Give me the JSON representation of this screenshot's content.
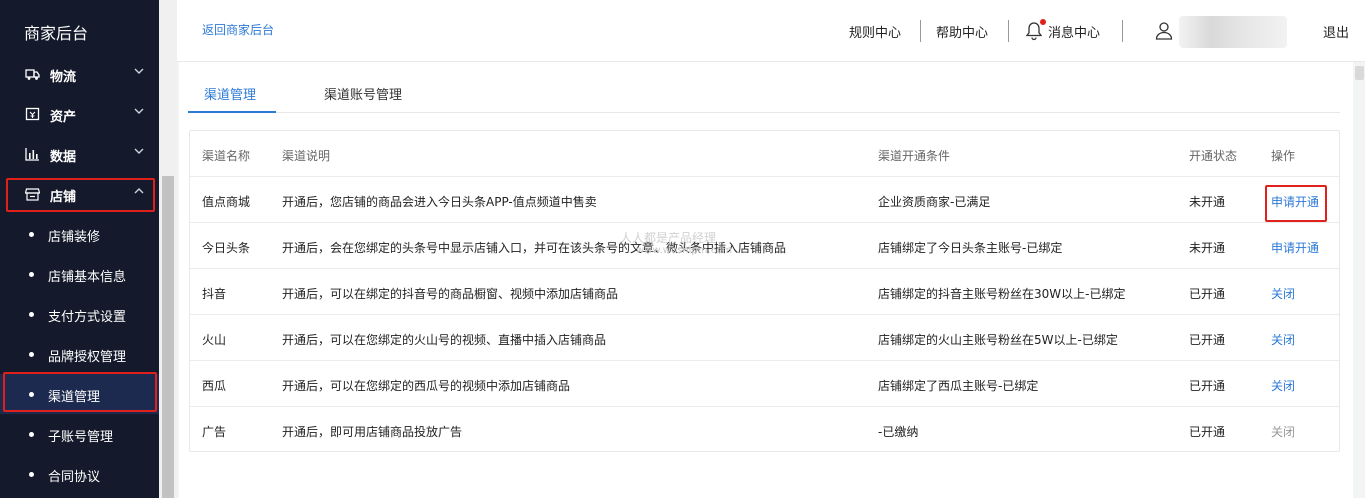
{
  "sidebar": {
    "title": "商家后台",
    "menu": [
      {
        "label": "物流",
        "icon": "truck-icon"
      },
      {
        "label": "资产",
        "icon": "wallet-icon"
      },
      {
        "label": "数据",
        "icon": "bar-chart-icon"
      },
      {
        "label": "店铺",
        "icon": "store-icon"
      }
    ],
    "sub_items": [
      {
        "label": "店铺装修"
      },
      {
        "label": "店铺基本信息"
      },
      {
        "label": "支付方式设置"
      },
      {
        "label": "品牌授权管理"
      },
      {
        "label": "渠道管理"
      },
      {
        "label": "子账号管理"
      },
      {
        "label": "合同协议"
      }
    ]
  },
  "header": {
    "back_link": "返回商家后台",
    "rules": "规则中心",
    "help": "帮助中心",
    "messages": "消息中心",
    "logout": "退出"
  },
  "tabs": [
    {
      "label": "渠道管理",
      "active": true
    },
    {
      "label": "渠道账号管理",
      "active": false
    }
  ],
  "table": {
    "headers": [
      "渠道名称",
      "渠道说明",
      "渠道开通条件",
      "开通状态",
      "操作"
    ],
    "rows": [
      {
        "name": "值点商城",
        "desc": "开通后，您店铺的商品会进入今日头条APP-值点频道中售卖",
        "cond": "企业资质商家-已满足",
        "status": "未开通",
        "action": "申请开通",
        "action_style": "blue"
      },
      {
        "name": "今日头条",
        "desc": "开通后，会在您绑定的头条号中显示店铺入口，并可在该头条号的文章、微头条中插入店铺商品",
        "cond": "店铺绑定了今日头条主账号-已绑定",
        "status": "未开通",
        "action": "申请开通",
        "action_style": "blue"
      },
      {
        "name": "抖音",
        "desc": "开通后，可以在绑定的抖音号的商品橱窗、视频中添加店铺商品",
        "cond": "店铺绑定的抖音主账号粉丝在30W以上-已绑定",
        "status": "已开通",
        "action": "关闭",
        "action_style": "blue"
      },
      {
        "name": "火山",
        "desc": "开通后，可以在您绑定的火山号的视频、直播中插入店铺商品",
        "cond": "店铺绑定的火山主账号粉丝在5W以上-已绑定",
        "status": "已开通",
        "action": "关闭",
        "action_style": "blue"
      },
      {
        "name": "西瓜",
        "desc": "开通后，可以在您绑定的西瓜号的视频中添加店铺商品",
        "cond": "店铺绑定了西瓜主账号-已绑定",
        "status": "已开通",
        "action": "关闭",
        "action_style": "blue"
      },
      {
        "name": "广告",
        "desc": "开通后，即可用店铺商品投放广告",
        "cond": "-已缴纳",
        "status": "已开通",
        "action": "关闭",
        "action_style": "gray"
      }
    ]
  },
  "watermark": {
    "line1": "人人都是产品经理",
    "line2": "www.woshipm.com"
  },
  "colors": {
    "sidebar_bg": "#141a2b",
    "accent": "#2d7ad6",
    "highlight": "#e0201b"
  }
}
